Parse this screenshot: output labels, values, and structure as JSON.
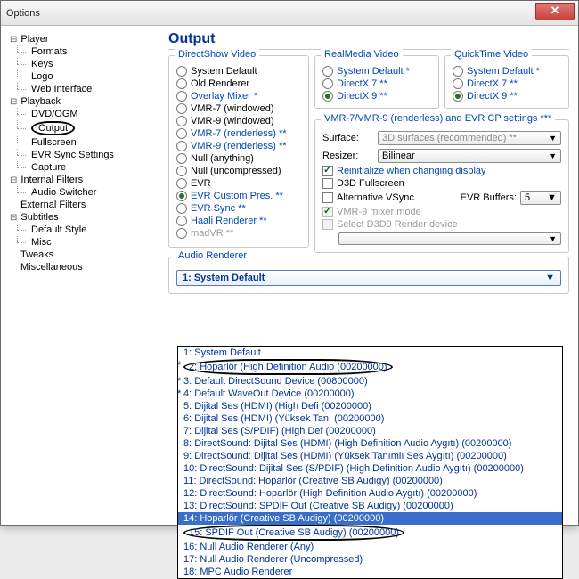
{
  "window": {
    "title": "Options"
  },
  "tree": {
    "player": {
      "label": "Player",
      "formats": "Formats",
      "keys": "Keys",
      "logo": "Logo",
      "web": "Web Interface"
    },
    "playback": {
      "label": "Playback",
      "dvd": "DVD/OGM",
      "output": "Output",
      "fullscreen": "Fullscreen",
      "evr": "EVR Sync Settings",
      "capture": "Capture"
    },
    "ifilters": {
      "label": "Internal Filters",
      "audio": "Audio Switcher"
    },
    "efilters": "External Filters",
    "subtitles": {
      "label": "Subtitles",
      "defstyle": "Default Style",
      "misc": "Misc"
    },
    "tweaks": "Tweaks",
    "misc": "Miscellaneous"
  },
  "main": {
    "heading": "Output",
    "ds": {
      "title": "DirectShow Video",
      "items": [
        {
          "label": "System Default",
          "sel": false
        },
        {
          "label": "Old Renderer",
          "sel": false
        },
        {
          "label": "Overlay Mixer *",
          "sel": false
        },
        {
          "label": "VMR-7 (windowed)",
          "sel": false
        },
        {
          "label": "VMR-9 (windowed)",
          "sel": false
        },
        {
          "label": "VMR-7 (renderless) **",
          "sel": false
        },
        {
          "label": "VMR-9 (renderless) **",
          "sel": false
        },
        {
          "label": "Null (anything)",
          "sel": false
        },
        {
          "label": "Null (uncompressed)",
          "sel": false
        },
        {
          "label": "EVR",
          "sel": false
        },
        {
          "label": "EVR Custom Pres. **",
          "sel": true
        },
        {
          "label": "EVR Sync **",
          "sel": false
        },
        {
          "label": "Haali Renderer **",
          "sel": false
        },
        {
          "label": "madVR **",
          "sel": false,
          "dis": true
        }
      ]
    },
    "rm": {
      "title": "RealMedia Video",
      "items": [
        {
          "label": "System Default *",
          "sel": false
        },
        {
          "label": "DirectX 7 **",
          "sel": false
        },
        {
          "label": "DirectX 9 **",
          "sel": true
        }
      ]
    },
    "qt": {
      "title": "QuickTime Video",
      "items": [
        {
          "label": "System Default *",
          "sel": false
        },
        {
          "label": "DirectX 7 **",
          "sel": false
        },
        {
          "label": "DirectX 9 **",
          "sel": true
        }
      ]
    },
    "vmr": {
      "title": "VMR-7/VMR-9 (renderless) and EVR CP settings ***",
      "surface_label": "Surface:",
      "surface_value": "3D surfaces (recommended) **",
      "resizer_label": "Resizer:",
      "resizer_value": "Bilinear",
      "reinit": "Reinitialize when changing display",
      "d3d": "D3D Fullscreen",
      "altv": "Alternative VSync",
      "evrbuf_label": "EVR Buffers:",
      "evrbuf_value": "5",
      "mixer": "VMR-9 mixer mode",
      "d3d9": "Select D3D9 Render device",
      "device": ""
    },
    "audio": {
      "title": "Audio Renderer",
      "selected": "1: System Default",
      "options": [
        "1: System Default",
        "2: Hoparlör (High Definition Audio (00200000)",
        "3: Default DirectSound Device (00800000)",
        "4: Default WaveOut Device (00200000)",
        "5: Dijital Ses (HDMI) (High Defi (00200000)",
        "6: Dijital Ses (HDMI) (Yüksek Tanı (00200000)",
        "7: Dijital Ses (S/PDIF) (High Def (00200000)",
        "8: DirectSound: Dijital Ses (HDMI) (High Definition Audio Aygıtı) (00200000)",
        "9: DirectSound: Dijital Ses (HDMI) (Yüksek Tanımlı Ses Aygıtı) (00200000)",
        "10: DirectSound: Dijital Ses (S/PDIF) (High Definition Audio Aygıtı) (00200000)",
        "11: DirectSound: Hoparlör (Creative SB Audigy) (00200000)",
        "12: DirectSound: Hoparlör (High Definition Audio Aygıtı) (00200000)",
        "13: DirectSound: SPDIF Out (Creative SB Audigy) (00200000)",
        "14: Hoparlör (Creative SB Audigy) (00200000)",
        "15: SPDIF Out (Creative SB Audigy) (00200000)",
        "16: Null Audio Renderer (Any)",
        "17: Null Audio Renderer (Uncompressed)",
        "18: MPC Audio Renderer"
      ],
      "star_idx": [
        1,
        2,
        3
      ],
      "circled_idx": [
        1,
        14
      ],
      "highlight_idx": 13
    }
  }
}
